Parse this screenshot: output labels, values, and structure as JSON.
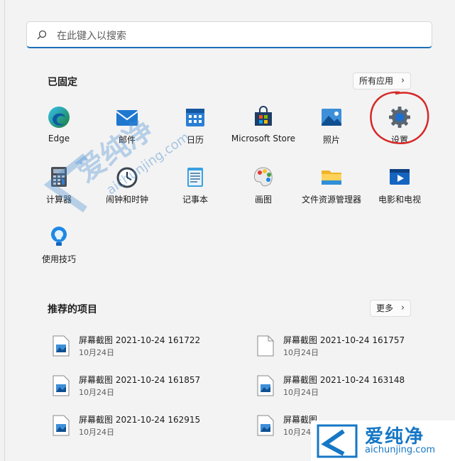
{
  "search": {
    "placeholder": "在此键入以搜索"
  },
  "pinned": {
    "title": "已固定",
    "all_apps_label": "所有应用",
    "apps": [
      {
        "label": "Edge",
        "icon": "edge-icon"
      },
      {
        "label": "邮件",
        "icon": "mail-icon"
      },
      {
        "label": "日历",
        "icon": "calendar-icon"
      },
      {
        "label": "Microsoft Store",
        "icon": "store-icon"
      },
      {
        "label": "照片",
        "icon": "photos-icon"
      },
      {
        "label": "设置",
        "icon": "settings-icon"
      },
      {
        "label": "计算器",
        "icon": "calculator-icon"
      },
      {
        "label": "闹钟和时钟",
        "icon": "clock-icon"
      },
      {
        "label": "记事本",
        "icon": "notepad-icon"
      },
      {
        "label": "画图",
        "icon": "paint-icon"
      },
      {
        "label": "文件资源管理器",
        "icon": "folder-icon"
      },
      {
        "label": "电影和电视",
        "icon": "movies-icon"
      },
      {
        "label": "使用技巧",
        "icon": "tips-icon"
      }
    ]
  },
  "recommended": {
    "title": "推荐的项目",
    "more_label": "更多",
    "items": [
      {
        "name": "屏幕截图 2021-10-24 161722",
        "date": "10月24日"
      },
      {
        "name": "屏幕截图 2021-10-24 161757",
        "date": "10月24日"
      },
      {
        "name": "屏幕截图 2021-10-24 161857",
        "date": "10月24日"
      },
      {
        "name": "屏幕截图 2021-10-24 163148",
        "date": "10月24日"
      },
      {
        "name": "屏幕截图 2021-10-24 162915",
        "date": "10月24日"
      },
      {
        "name": "屏幕截图",
        "date": "10月24日"
      }
    ]
  },
  "watermark": {
    "brand_cn": "爱纯净",
    "brand_url": "aichunjing.com"
  },
  "colors": {
    "accent": "#1a6fb8",
    "annotation": "#d62828"
  }
}
